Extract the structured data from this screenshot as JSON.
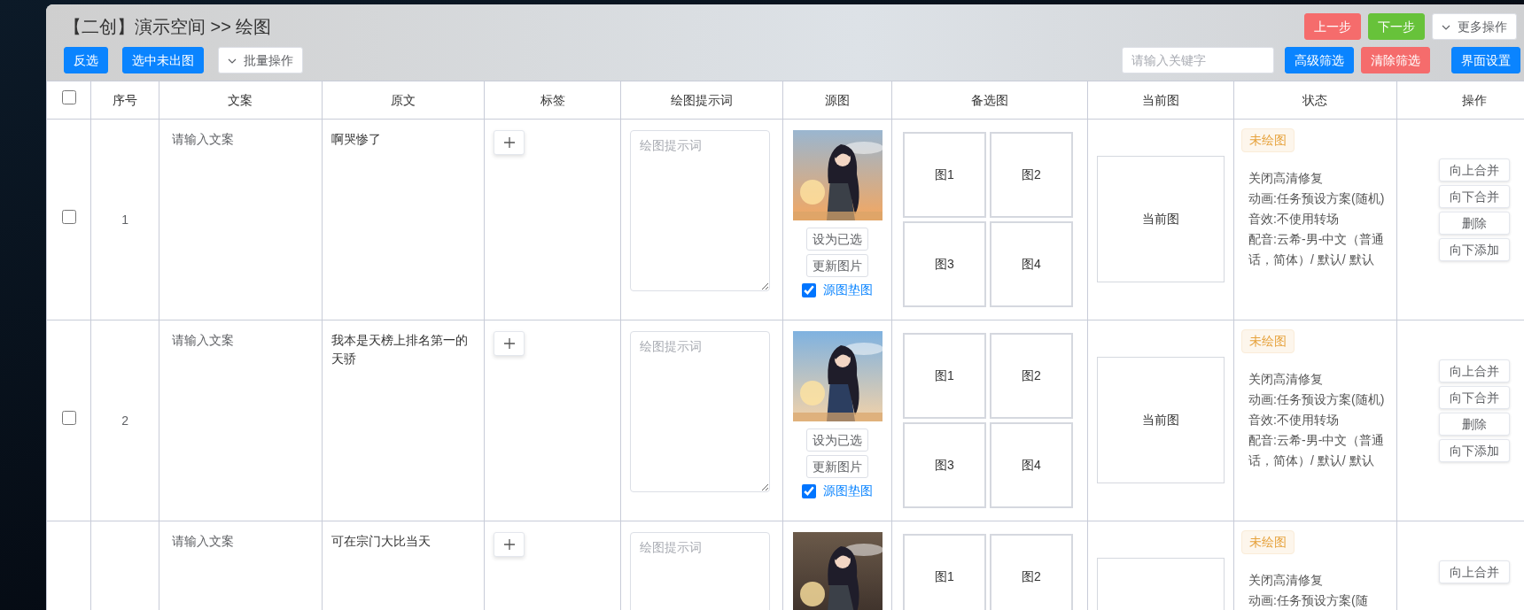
{
  "header": {
    "title": "【二创】演示空间 >> 绘图",
    "nav_buttons": [
      {
        "label": "上一步",
        "kind": "danger"
      },
      {
        "label": "下一步",
        "kind": "success"
      },
      {
        "label": "更多操作",
        "kind": "dropdown"
      }
    ]
  },
  "toolbar": {
    "left_buttons": [
      {
        "label": "反选",
        "kind": "primary"
      },
      {
        "label": "选中未出图",
        "kind": "primary"
      },
      {
        "label": "批量操作",
        "kind": "dropdown"
      }
    ],
    "search": {
      "placeholder": "请输入关键字"
    },
    "right_buttons": [
      {
        "label": "高级筛选",
        "kind": "primary"
      },
      {
        "label": "清除筛选",
        "kind": "danger"
      },
      {
        "label": "界面设置",
        "kind": "primary"
      }
    ]
  },
  "table": {
    "select_all": {
      "checked": false
    },
    "columns": [
      "序号",
      "文案",
      "原文",
      "标签",
      "绘图提示词",
      "源图",
      "备选图",
      "当前图",
      "状态",
      "操作"
    ],
    "rows": [
      {
        "selected": false,
        "index": "1",
        "copy_placeholder": "请输入文案",
        "original": "啊哭惨了",
        "prompt_placeholder": "绘图提示词",
        "source_image": {
          "kind": "picture"
        },
        "source_buttons": [
          "设为已选",
          "更新图片"
        ],
        "source_as_base": {
          "label": "源图垫图",
          "checked": true
        },
        "candidates": [
          "图1",
          "图2",
          "图3",
          "图4"
        ],
        "current": "当前图",
        "status": {
          "label": "未绘图",
          "kind": "pending"
        },
        "status_lines": [
          "关闭高清修复",
          "动画:任务预设方案(随机)",
          "音效:不使用转场",
          "配音:云希-男-中文（普通话，简体）/ 默认/ 默认"
        ],
        "actions": [
          "向上合并",
          "向下合并",
          "删除",
          "向下添加"
        ]
      },
      {
        "selected": false,
        "index": "2",
        "copy_placeholder": "请输入文案",
        "original": "我本是天榜上排名第一的天骄",
        "prompt_placeholder": "绘图提示词",
        "source_image": {
          "kind": "picture"
        },
        "source_buttons": [
          "设为已选",
          "更新图片"
        ],
        "source_as_base": {
          "label": "源图垫图",
          "checked": true
        },
        "candidates": [
          "图1",
          "图2",
          "图3",
          "图4"
        ],
        "current": "当前图",
        "status": {
          "label": "未绘图",
          "kind": "pending"
        },
        "status_lines": [
          "关闭高清修复",
          "动画:任务预设方案(随机)",
          "音效:不使用转场",
          "配音:云希-男-中文（普通话，简体）/ 默认/ 默认"
        ],
        "actions": [
          "向上合并",
          "向下合并",
          "删除",
          "向下添加"
        ]
      },
      {
        "copy_placeholder": "请输入文案",
        "original": "可在宗门大比当天",
        "prompt_placeholder": "绘图提示词",
        "source_image": {
          "kind": "picture"
        },
        "candidates": [
          "图1",
          "图2"
        ],
        "status": {
          "label": "未绘图",
          "kind": "pending"
        },
        "status_lines": [
          "关闭高清修复",
          "动画:任务预设方案(随"
        ],
        "actions": [
          "向上合并"
        ]
      }
    ]
  }
}
